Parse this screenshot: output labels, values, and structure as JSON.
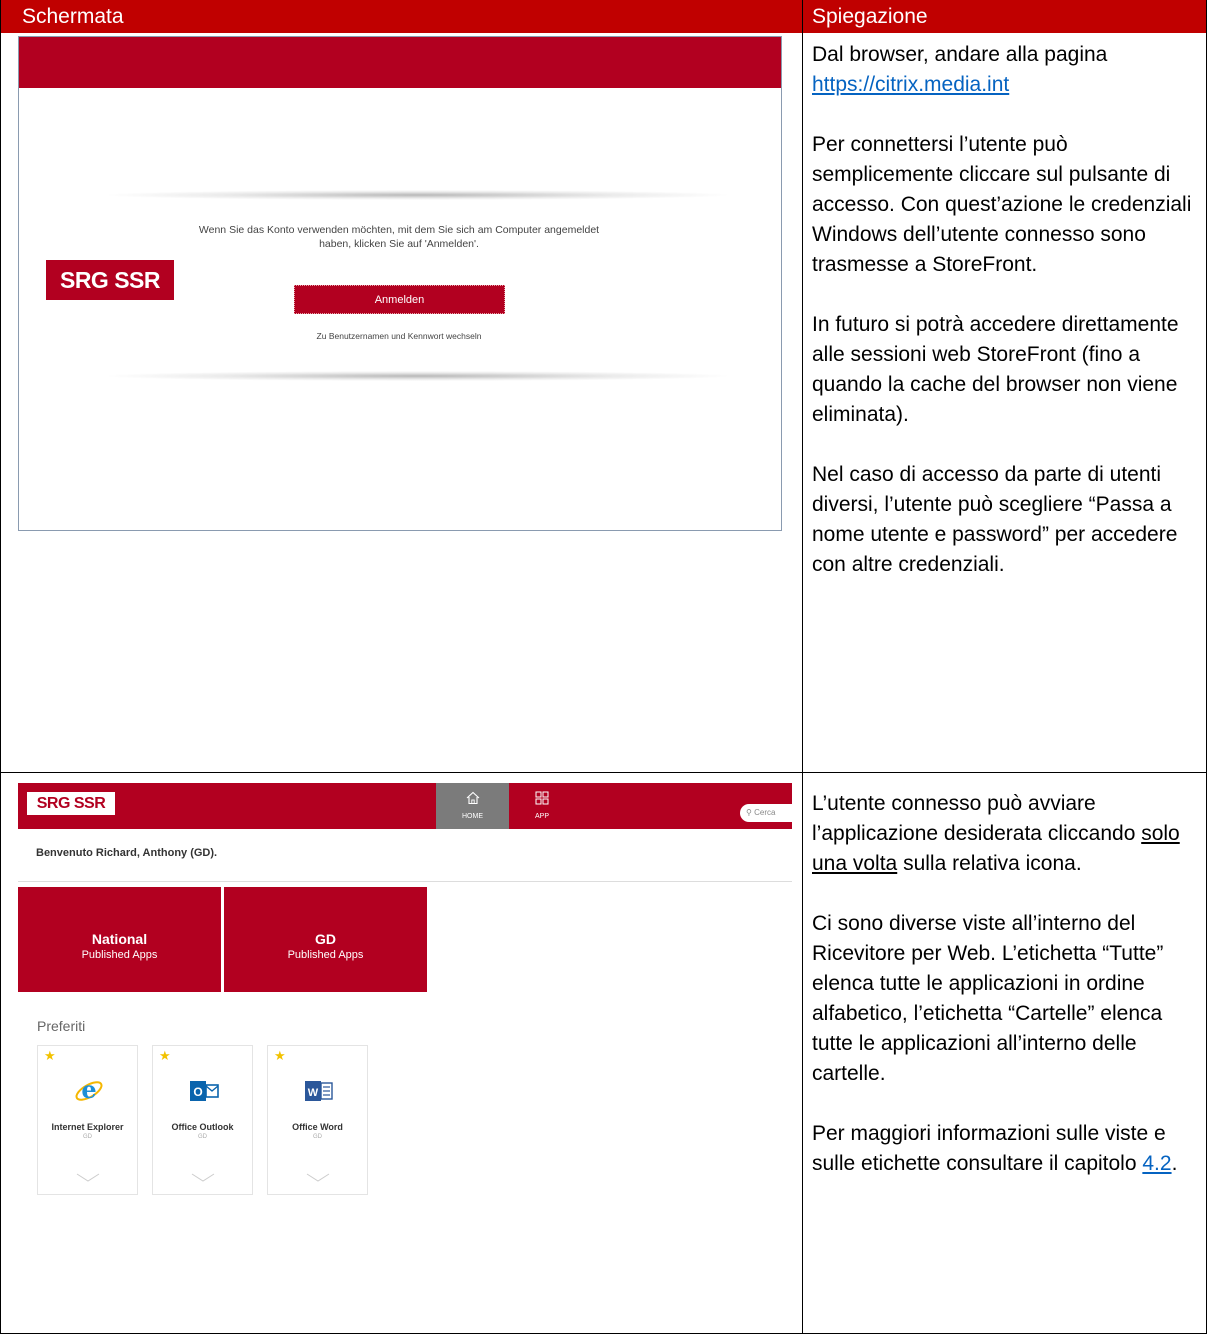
{
  "table": {
    "header_left": "Schermata",
    "header_right": "Spiegazione"
  },
  "row1": {
    "screenshot": {
      "logo": "SRG SSR",
      "message": "Wenn Sie das Konto verwenden möchten, mit dem Sie sich am Computer angemeldet haben, klicken Sie auf 'Anmelden'.",
      "signin_button": "Anmelden",
      "switch_link": "Zu Benutzernamen und Kennwort wechseln"
    },
    "explanation": {
      "p1_text": "Dal browser, andare alla pagina ",
      "p1_link": "https://citrix.media.int",
      "p2": "Per connettersi l’utente può semplicemente cliccare sul pulsante di accesso. Con quest’azione le credenziali Windows dell’utente connesso sono trasmesse a StoreFront.",
      "p3": "In futuro si potrà accedere direttamente alle sessioni web StoreFront (fino a quando la cache del browser non viene eliminata).",
      "p4": "Nel caso di accesso da parte di utenti diversi, l’utente può scegliere “Passa a nome utente e password” per accedere con altre credenziali."
    }
  },
  "row2": {
    "screenshot": {
      "logo": "SRG SSR",
      "nav_home": "HOME",
      "nav_app": "APP",
      "search_placeholder": "Cerca",
      "welcome": "Benvenuto Richard, Anthony (GD).",
      "tiles": [
        {
          "title": "National",
          "subtitle": "Published Apps"
        },
        {
          "title": "GD",
          "subtitle": "Published Apps"
        }
      ],
      "favorites_title": "Preferiti",
      "apps": [
        {
          "name": "Internet Explorer",
          "sub": "GD",
          "icon": "internet-explorer-icon"
        },
        {
          "name": "Office Outlook",
          "sub": "GD",
          "icon": "outlook-icon"
        },
        {
          "name": "Office Word",
          "sub": "GD",
          "icon": "word-icon"
        }
      ]
    },
    "explanation": {
      "p1_a": "L’utente connesso può avviare l’applicazione desiderata cliccando ",
      "p1_u": "solo una volta",
      "p1_b": " sulla relativa icona.",
      "p2": "Ci sono diverse viste all’interno del Ricevitore per Web. L’etichetta “Tutte” elenca tutte le applicazioni in ordine alfabetico, l’etichetta “Cartelle” elenca tutte le applicazioni all’interno delle cartelle.",
      "p3_a": "Per maggiori informazioni sulle viste e sulle etichette consultare il capitolo ",
      "p3_link": "4.2",
      "p3_b": "."
    }
  },
  "colors": {
    "header_red": "#c00000",
    "brand_red": "#b20020",
    "link_blue": "#0563c1"
  }
}
